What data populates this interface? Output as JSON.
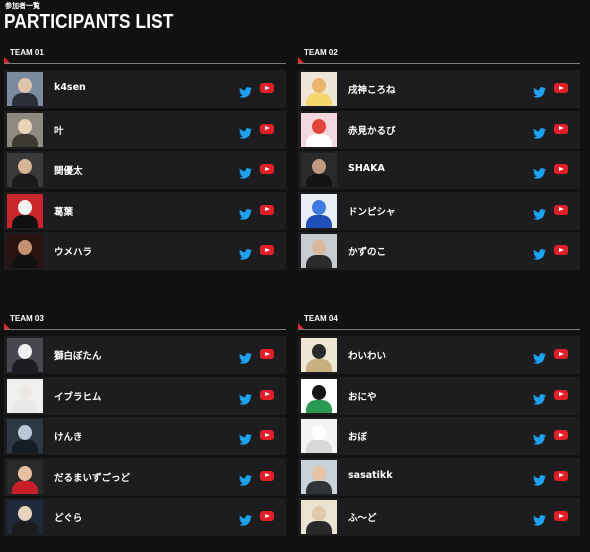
{
  "page": {
    "subtitle": "参加者一覧",
    "title": "PARTICIPANTS LIST"
  },
  "colors": {
    "accent": "#e6272c",
    "twitter": "#1da1f2",
    "youtube": "#e21e26",
    "row_bg": "#1d1d1f"
  },
  "teams": [
    {
      "label": "TEAM 01",
      "members": [
        {
          "name": "k4sen",
          "twitter_icon": "twitter-icon",
          "youtube_icon": "youtube-icon"
        },
        {
          "name": "叶",
          "twitter_icon": "twitter-icon",
          "youtube_icon": "youtube-icon"
        },
        {
          "name": "関優太",
          "twitter_icon": "twitter-icon",
          "youtube_icon": "youtube-icon"
        },
        {
          "name": "葛葉",
          "twitter_icon": "twitter-icon",
          "youtube_icon": "youtube-icon"
        },
        {
          "name": "ウメハラ",
          "twitter_icon": "twitter-icon",
          "youtube_icon": "youtube-icon"
        }
      ]
    },
    {
      "label": "TEAM 02",
      "members": [
        {
          "name": "戌神ころね",
          "twitter_icon": "twitter-icon",
          "youtube_icon": "youtube-icon"
        },
        {
          "name": "赤見かるび",
          "twitter_icon": "twitter-icon",
          "youtube_icon": "youtube-icon"
        },
        {
          "name": "SHAKA",
          "twitter_icon": "twitter-icon",
          "youtube_icon": "youtube-icon"
        },
        {
          "name": "ドンピシャ",
          "twitter_icon": "twitter-icon",
          "youtube_icon": "youtube-icon"
        },
        {
          "name": "かずのこ",
          "twitter_icon": "twitter-icon",
          "youtube_icon": "youtube-icon"
        }
      ]
    },
    {
      "label": "TEAM 03",
      "members": [
        {
          "name": "獅白ぼたん",
          "twitter_icon": "twitter-icon",
          "youtube_icon": "youtube-icon"
        },
        {
          "name": "イブラヒム",
          "twitter_icon": "twitter-icon",
          "youtube_icon": "youtube-icon"
        },
        {
          "name": "けんき",
          "twitter_icon": "twitter-icon",
          "youtube_icon": "youtube-icon"
        },
        {
          "name": "だるまいずごっど",
          "twitter_icon": "twitter-icon",
          "youtube_icon": "youtube-icon"
        },
        {
          "name": "どぐら",
          "twitter_icon": "twitter-icon",
          "youtube_icon": "youtube-icon"
        }
      ]
    },
    {
      "label": "TEAM 04",
      "members": [
        {
          "name": "わいわい",
          "twitter_icon": "twitter-icon",
          "youtube_icon": "youtube-icon"
        },
        {
          "name": "おにや",
          "twitter_icon": "twitter-icon",
          "youtube_icon": "youtube-icon"
        },
        {
          "name": "おぼ",
          "twitter_icon": "twitter-icon",
          "youtube_icon": "youtube-icon"
        },
        {
          "name": "sasatikk",
          "twitter_icon": "twitter-icon",
          "youtube_icon": "youtube-icon"
        },
        {
          "name": "ふ～ど",
          "twitter_icon": "twitter-icon",
          "youtube_icon": "youtube-icon"
        }
      ]
    }
  ]
}
